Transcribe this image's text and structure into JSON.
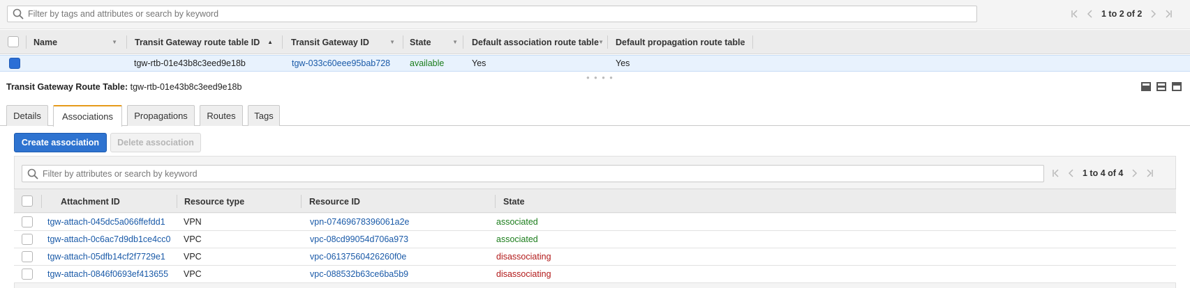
{
  "top_filter": {
    "placeholder": "Filter by tags and attributes or search by keyword",
    "pagination": "1 to 2 of 2"
  },
  "top_table": {
    "columns": [
      "Name",
      "Transit Gateway route table ID",
      "Transit Gateway ID",
      "State",
      "Default association route table",
      "Default propagation route table"
    ],
    "rows": [
      {
        "name": "",
        "route_table_id": "tgw-rtb-01e43b8c3eed9e18b",
        "transit_gateway_id": "tgw-033c60eee95bab728",
        "state": "available",
        "default_association": "Yes",
        "default_propagation": "Yes",
        "selected": true
      }
    ]
  },
  "detail": {
    "title_label": "Transit Gateway Route Table:",
    "title_value": "tgw-rtb-01e43b8c3eed9e18b"
  },
  "tabs": [
    {
      "label": "Details",
      "active": false
    },
    {
      "label": "Associations",
      "active": true
    },
    {
      "label": "Propagations",
      "active": false
    },
    {
      "label": "Routes",
      "active": false
    },
    {
      "label": "Tags",
      "active": false
    }
  ],
  "actions": {
    "create_label": "Create association",
    "delete_label": "Delete association"
  },
  "assoc_filter": {
    "placeholder": "Filter by attributes or search by keyword",
    "pagination": "1 to 4 of 4"
  },
  "assoc_table": {
    "columns": [
      "Attachment ID",
      "Resource type",
      "Resource ID",
      "State"
    ],
    "rows": [
      {
        "attachment_id": "tgw-attach-045dc5a066ffefdd1",
        "resource_type": "VPN",
        "resource_id": "vpn-07469678396061a2e",
        "state": "associated"
      },
      {
        "attachment_id": "tgw-attach-0c6ac7d9db1ce4cc0",
        "resource_type": "VPC",
        "resource_id": "vpc-08cd99054d706a973",
        "state": "associated"
      },
      {
        "attachment_id": "tgw-attach-05dfb14cf2f7729e1",
        "resource_type": "VPC",
        "resource_id": "vpc-06137560426260f0e",
        "state": "disassociating"
      },
      {
        "attachment_id": "tgw-attach-0846f0693ef413655",
        "resource_type": "VPC",
        "resource_id": "vpc-088532b63ce6ba5b9",
        "state": "disassociating"
      }
    ]
  },
  "colors": {
    "primary_button": "#2e73d0",
    "link": "#1a5aa8",
    "state_ok": "#1b7d1b",
    "state_bad": "#b21a1a",
    "active_tab_accent": "#e69a1a",
    "selected_row": "#e8f2fd"
  }
}
